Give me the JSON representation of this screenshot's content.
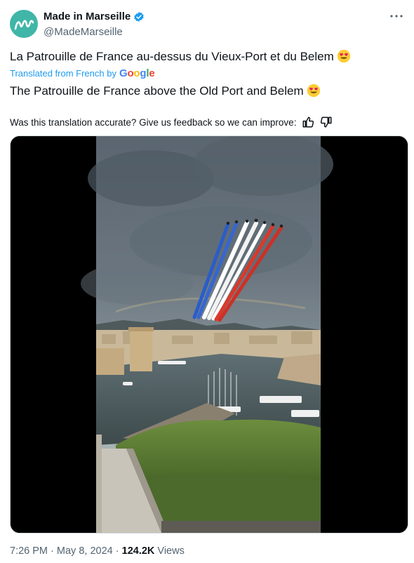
{
  "author": {
    "display_name": "Made in Marseille",
    "handle": "@MadeMarseille",
    "verified": true,
    "avatar_color": "#3fb6a8"
  },
  "tweet": {
    "original_text": "La Patrouille de France au-dessus du Vieux-Port et du Belem",
    "translated_from": "Translated from French by",
    "translated_by_brand": "Google",
    "translated_text": "The Patrouille de France above the Old Port and Belem",
    "emoji": "heart-eyes-emoji",
    "feedback_prompt": "Was this translation accurate? Give us feedback so we can improve:"
  },
  "media": {
    "type": "video",
    "smoke_colors": [
      "#2b5dc9",
      "#ffffff",
      "#d9392b"
    ]
  },
  "meta": {
    "time": "7:26 PM",
    "date": "May 8, 2024",
    "views_count": "124.2K",
    "views_label": "Views"
  },
  "colors": {
    "link_blue": "#1d9bf0",
    "secondary_text": "#536471",
    "verified_blue": "#1d9bf0"
  }
}
